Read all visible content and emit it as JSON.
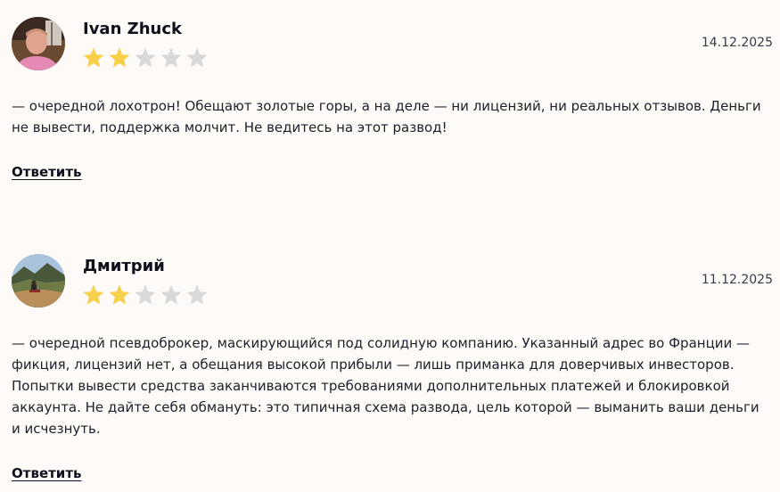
{
  "colors": {
    "star_filled": "#f7cf4a",
    "star_empty": "#d9d9d9",
    "background": "#fdfaf7"
  },
  "reviews": [
    {
      "author": "Ivan Zhuck",
      "date": "14.12.2025",
      "rating": 2,
      "max_rating": 5,
      "avatar_icon": "user-photo-icon",
      "text": "— очередной лохотрон! Обещают золотые горы, а на деле — ни лицензий, ни реальных отзывов. Деньги не вывести, поддержка молчит. Не ведитесь на этот развод!",
      "reply_label": "Ответить"
    },
    {
      "author": "Дмитрий",
      "date": "11.12.2025",
      "rating": 2,
      "max_rating": 5,
      "avatar_icon": "landscape-photo-icon",
      "text": "— очередной псевдоброкер, маскирующийся под солидную компанию. Указанный адрес во Франции — фикция, лицензий нет, а обещания высокой прибыли — лишь приманка для доверчивых инвесторов. Попытки вывести средства заканчиваются требованиями дополнительных платежей и блокировкой аккаунта. Не дайте себя обмануть: это типичная схема развода, цель которой — выманить ваши деньги и исчезнуть.",
      "reply_label": "Ответить"
    }
  ]
}
